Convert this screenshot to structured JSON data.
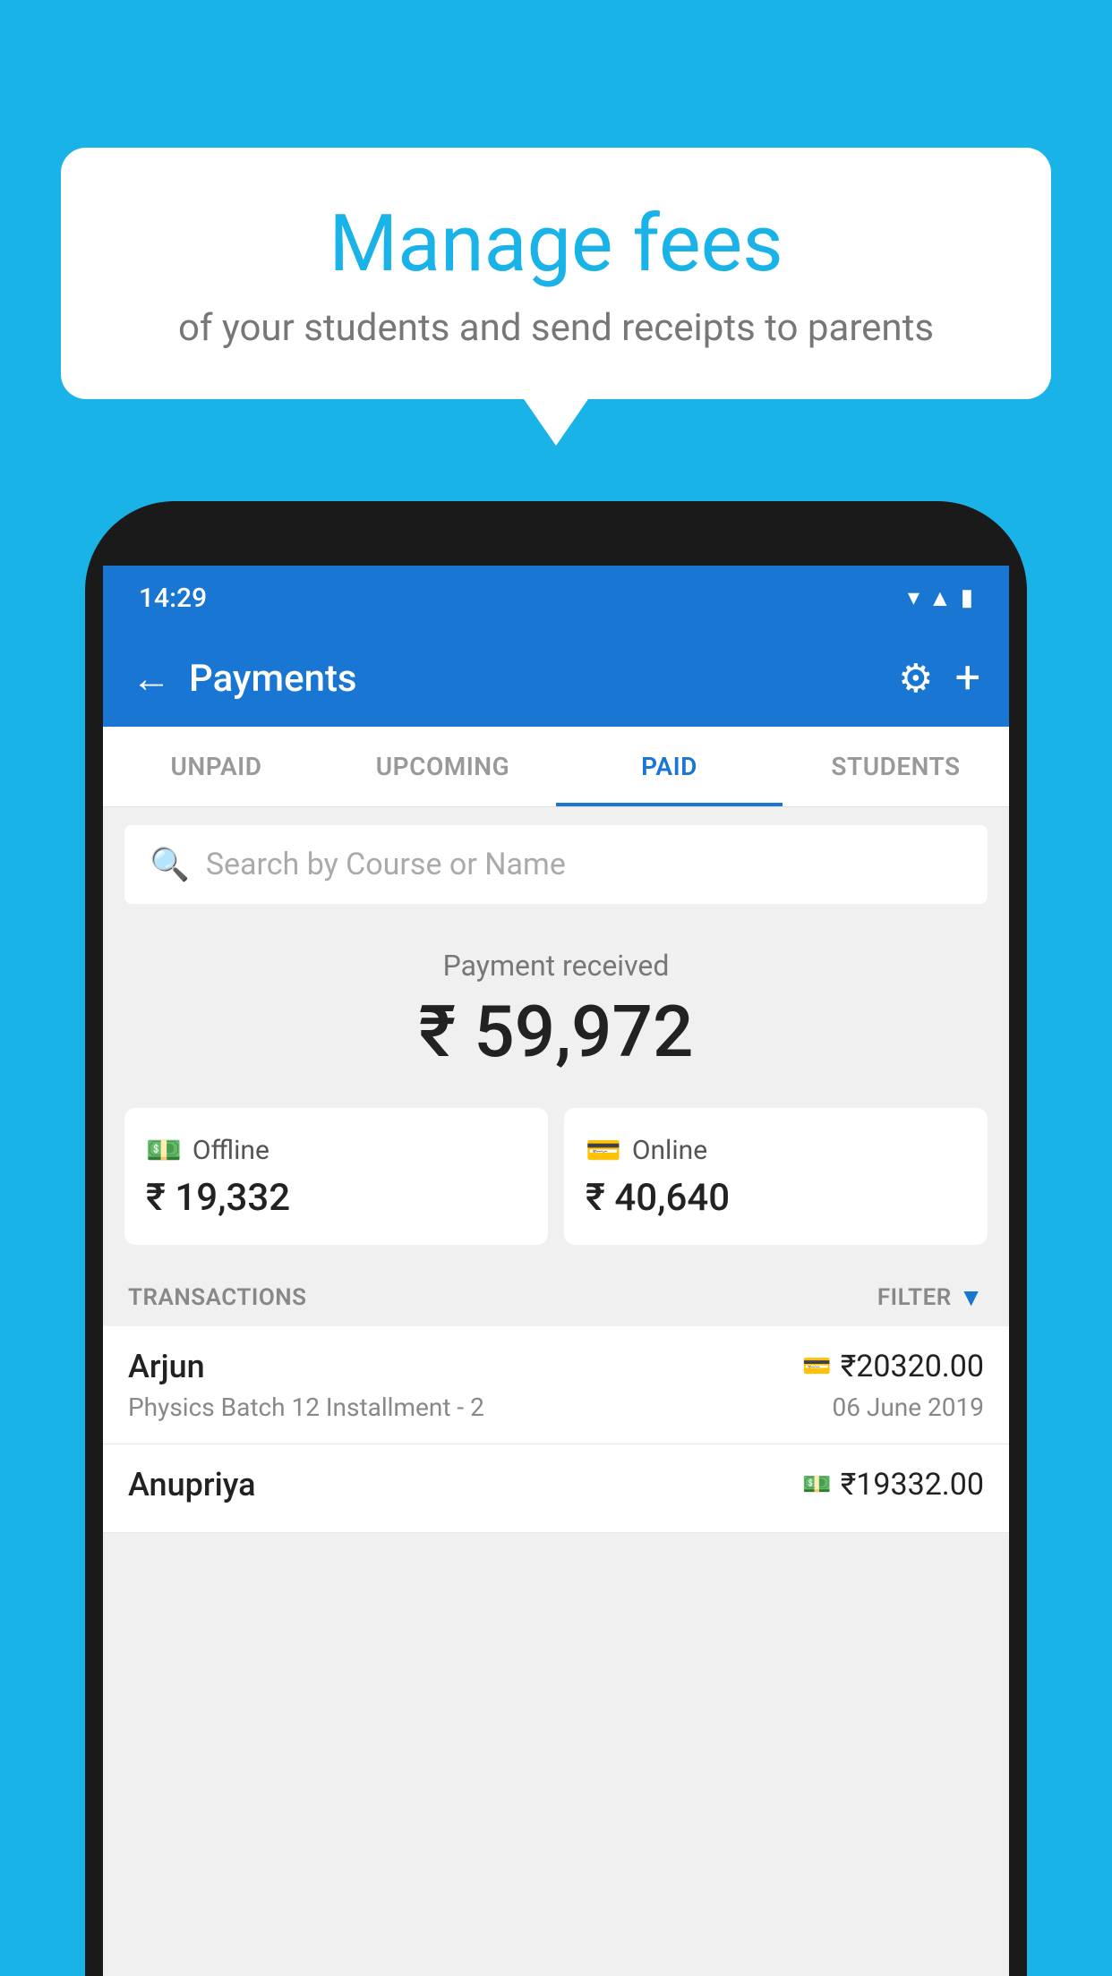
{
  "background_color": "#1ab3e8",
  "speech_bubble": {
    "title": "Manage fees",
    "subtitle": "of your students and send receipts to parents"
  },
  "status_bar": {
    "time": "14:29",
    "icons": [
      "wifi",
      "signal",
      "battery"
    ]
  },
  "app_bar": {
    "title": "Payments",
    "back_label": "←",
    "gear_label": "⚙",
    "plus_label": "+"
  },
  "tabs": [
    {
      "label": "UNPAID",
      "active": false
    },
    {
      "label": "UPCOMING",
      "active": false
    },
    {
      "label": "PAID",
      "active": true
    },
    {
      "label": "STUDENTS",
      "active": false
    }
  ],
  "search": {
    "placeholder": "Search by Course or Name"
  },
  "payment": {
    "label": "Payment received",
    "amount": "₹ 59,972",
    "offline": {
      "label": "Offline",
      "amount": "₹ 19,332"
    },
    "online": {
      "label": "Online",
      "amount": "₹ 40,640"
    }
  },
  "transactions": {
    "section_label": "TRANSACTIONS",
    "filter_label": "FILTER",
    "rows": [
      {
        "name": "Arjun",
        "amount": "₹20320.00",
        "course": "Physics Batch 12 Installment - 2",
        "date": "06 June 2019",
        "method_icon": "card"
      },
      {
        "name": "Anupriya",
        "amount": "₹19332.00",
        "course": "",
        "date": "",
        "method_icon": "cash"
      }
    ]
  }
}
